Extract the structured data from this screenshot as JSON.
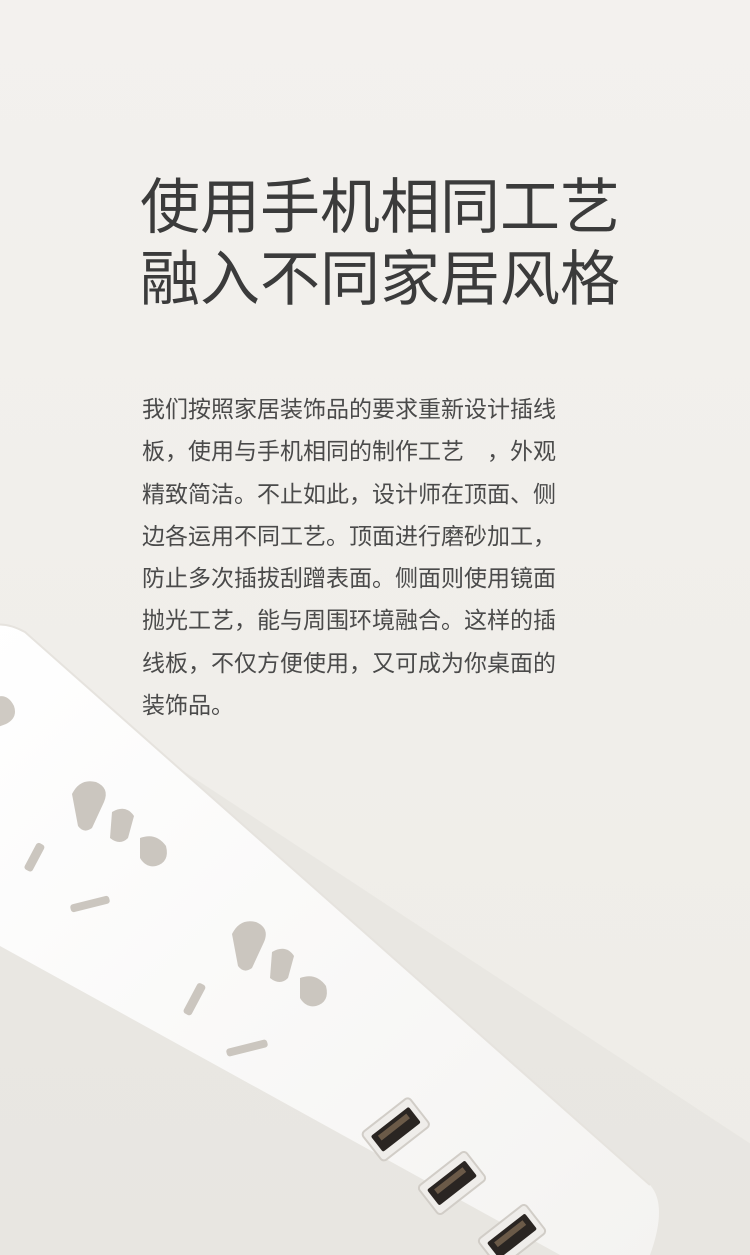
{
  "headline": {
    "line1": "使用手机相同工艺",
    "line2": "融入不同家居风格"
  },
  "body": {
    "lines": [
      "我们按照家居装饰品的要求重新设计插线",
      "板，使用与手机相同的制作工艺　，外观",
      "精致简洁。不止如此，设计师在顶面、侧",
      "边各运用不同工艺。顶面进行磨砂加工，",
      "防止多次插拔刮蹭表面。侧面则使用镜面",
      "抛光工艺，能与周围环境融合。这样的插",
      "线板，不仅方便使用，又可成为你桌面的",
      "装饰品。"
    ]
  },
  "product": {
    "name": "power-strip-image",
    "body_color": "#fbfbfa",
    "shadow_color": "#d9d6d0",
    "slot_color": "#c9c4bd",
    "usb_port_color": "#2a2522"
  }
}
